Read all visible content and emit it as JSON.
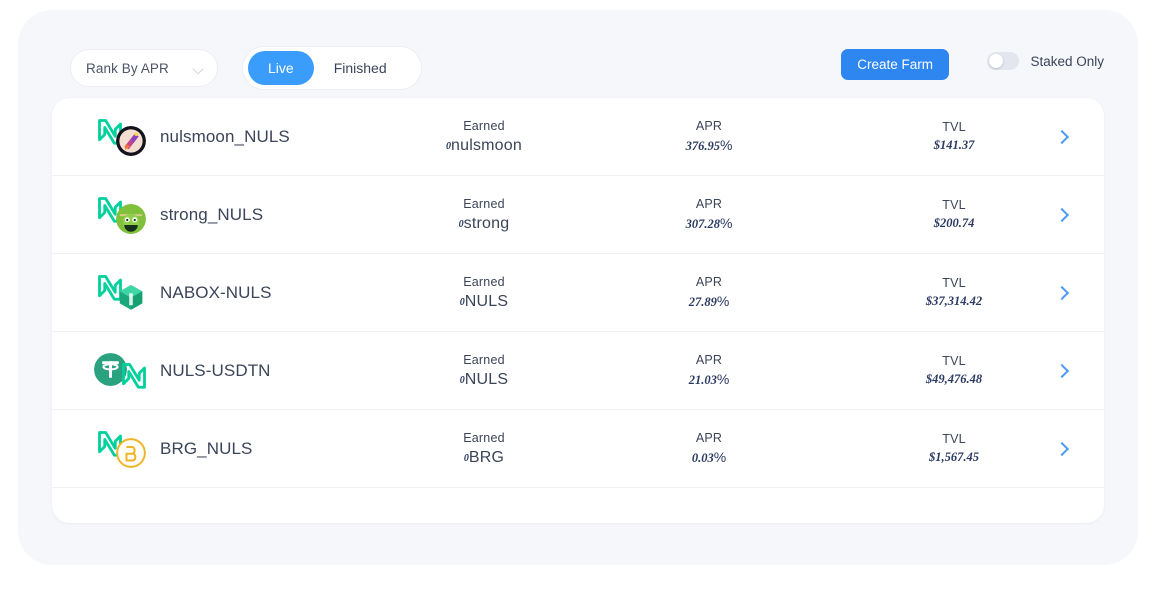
{
  "toolbar": {
    "rank_select_value": "Rank By APR",
    "rank_select_icon": "chevron-down-icon",
    "tab_live": "Live",
    "tab_finished": "Finished",
    "active_tab": "Live",
    "create_farm_label": "Create Farm",
    "staked_only_label": "Staked Only",
    "staked_only_on": false,
    "accent_blue": "#2e86f0",
    "segment_active_blue": "#3b9dfb"
  },
  "columns": {
    "earned": "Earned",
    "apr": "APR",
    "tvl": "TVL"
  },
  "farms": [
    {
      "name": "nulsmoon_NULS",
      "earned_amount": "0",
      "earned_symbol": "nulsmoon",
      "apr": "376.95",
      "apr_unit": "%",
      "tvl": "$141.37",
      "icon_left": "nuls-icon",
      "icon_right": "nulsmoon-token-icon"
    },
    {
      "name": "strong_NULS",
      "earned_amount": "0",
      "earned_symbol": "strong",
      "apr": "307.28",
      "apr_unit": "%",
      "tvl": "$200.74",
      "icon_left": "nuls-icon",
      "icon_right": "strong-token-icon"
    },
    {
      "name": "NABOX-NULS",
      "earned_amount": "0",
      "earned_symbol": "NULS",
      "apr": "27.89",
      "apr_unit": "%",
      "tvl": "$37,314.42",
      "icon_left": "nuls-icon",
      "icon_right": "nabox-token-icon"
    },
    {
      "name": "NULS-USDTN",
      "earned_amount": "0",
      "earned_symbol": "NULS",
      "apr": "21.03",
      "apr_unit": "%",
      "tvl": "$49,476.48",
      "icon_left": "tether-icon",
      "icon_right": "nuls-icon"
    },
    {
      "name": "BRG_NULS",
      "earned_amount": "0",
      "earned_symbol": "BRG",
      "apr": "0.03",
      "apr_unit": "%",
      "tvl": "$1,567.45",
      "icon_left": "nuls-icon",
      "icon_right": "brg-token-icon"
    }
  ]
}
